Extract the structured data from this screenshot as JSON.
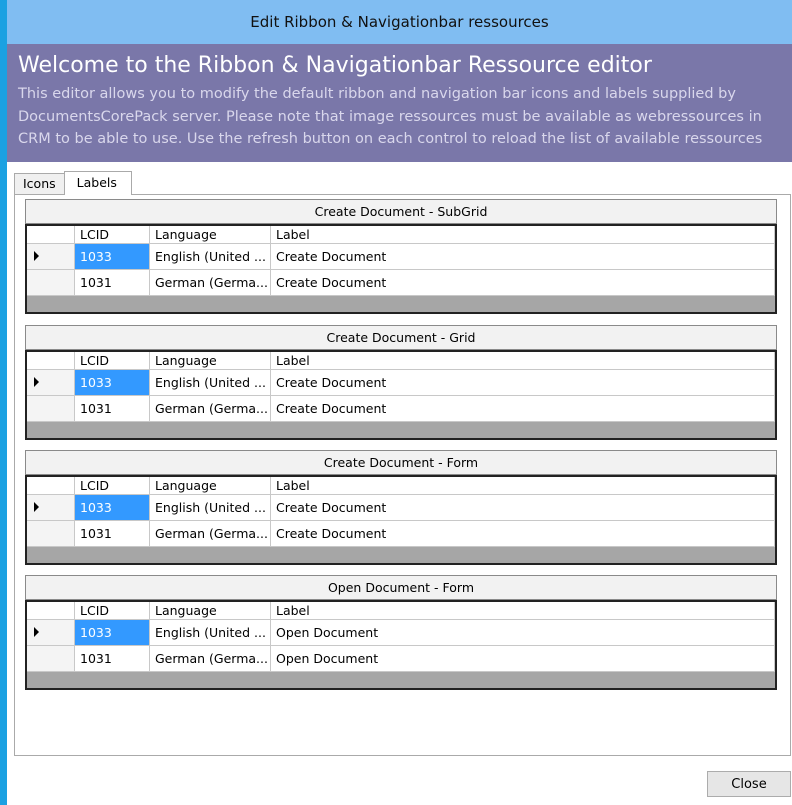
{
  "window": {
    "title": "Edit Ribbon & Navigationbar ressources"
  },
  "banner": {
    "heading": "Welcome to the Ribbon & Navigationbar Ressource editor",
    "description": "This editor allows you to modify the default ribbon and navigation bar icons and labels supplied by DocumentsCorePack server. Please note that image ressources must be available as webressources in CRM to be able to use. Use the refresh button on each control to reload the list of available ressources"
  },
  "tabs": [
    {
      "label": "Icons",
      "active": false
    },
    {
      "label": "Labels",
      "active": true
    }
  ],
  "columns": {
    "lcid": "LCID",
    "language": "Language",
    "label": "Label"
  },
  "groups": [
    {
      "title": "Create Document - SubGrid",
      "rows": [
        {
          "lcid": "1033",
          "language": "English (United ...",
          "label": "Create Document",
          "current": true
        },
        {
          "lcid": "1031",
          "language": "German (Germa...",
          "label": "Create Document",
          "current": false
        }
      ]
    },
    {
      "title": "Create Document - Grid",
      "rows": [
        {
          "lcid": "1033",
          "language": "English (United ...",
          "label": "Create Document",
          "current": true
        },
        {
          "lcid": "1031",
          "language": "German (Germa...",
          "label": "Create Document",
          "current": false
        }
      ]
    },
    {
      "title": "Create Document - Form",
      "rows": [
        {
          "lcid": "1033",
          "language": "English (United ...",
          "label": "Create Document",
          "current": true
        },
        {
          "lcid": "1031",
          "language": "German (Germa...",
          "label": "Create Document",
          "current": false
        }
      ]
    },
    {
      "title": "Open Document - Form",
      "rows": [
        {
          "lcid": "1033",
          "language": "English (United ...",
          "label": "Open Document",
          "current": true
        },
        {
          "lcid": "1031",
          "language": "German (Germa...",
          "label": "Open Document",
          "current": false
        }
      ]
    }
  ],
  "footer": {
    "close_label": "Close"
  },
  "colors": {
    "titlebar": "#80bdf2",
    "banner": "#7a77a9",
    "selection": "#3399ff",
    "frame": "#1ba1e2"
  },
  "icons": {
    "current_row": "row-pointer-icon"
  }
}
